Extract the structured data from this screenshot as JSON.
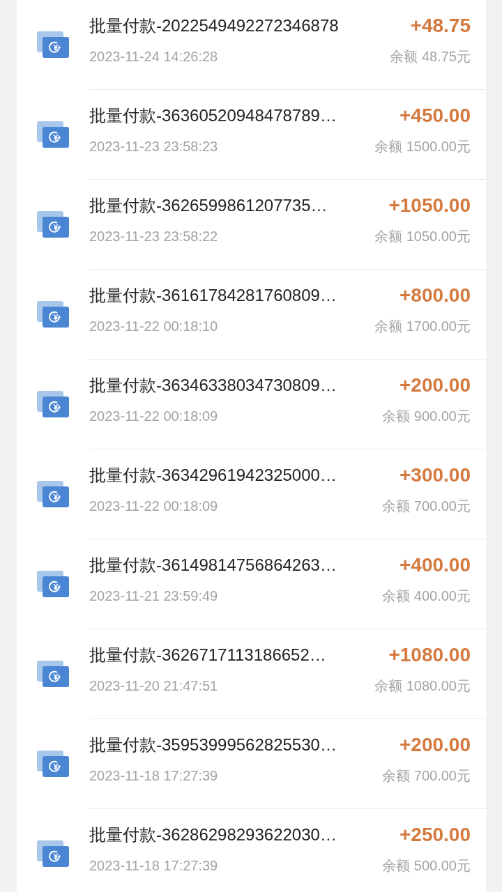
{
  "transactions": [
    {
      "title": "批量付款-2022549492272346878",
      "amount": "+48.75",
      "time": "2023-11-24 14:26:28",
      "balance": "余额 48.75元"
    },
    {
      "title": "批量付款-36360520948478789…",
      "amount": "+450.00",
      "time": "2023-11-23 23:58:23",
      "balance": "余额 1500.00元"
    },
    {
      "title": "批量付款-3626599861207735…",
      "amount": "+1050.00",
      "time": "2023-11-23 23:58:22",
      "balance": "余额 1050.00元"
    },
    {
      "title": "批量付款-36161784281760809…",
      "amount": "+800.00",
      "time": "2023-11-22 00:18:10",
      "balance": "余额 1700.00元"
    },
    {
      "title": "批量付款-36346338034730809…",
      "amount": "+200.00",
      "time": "2023-11-22 00:18:09",
      "balance": "余额 900.00元"
    },
    {
      "title": "批量付款-36342961942325000…",
      "amount": "+300.00",
      "time": "2023-11-22 00:18:09",
      "balance": "余额 700.00元"
    },
    {
      "title": "批量付款-36149814756864263…",
      "amount": "+400.00",
      "time": "2023-11-21 23:59:49",
      "balance": "余额 400.00元"
    },
    {
      "title": "批量付款-3626717113186652…",
      "amount": "+1080.00",
      "time": "2023-11-20 21:47:51",
      "balance": "余额 1080.00元"
    },
    {
      "title": "批量付款-35953999562825530…",
      "amount": "+200.00",
      "time": "2023-11-18 17:27:39",
      "balance": "余额 700.00元"
    },
    {
      "title": "批量付款-36286298293622030…",
      "amount": "+250.00",
      "time": "2023-11-18 17:27:39",
      "balance": "余额 500.00元"
    }
  ]
}
